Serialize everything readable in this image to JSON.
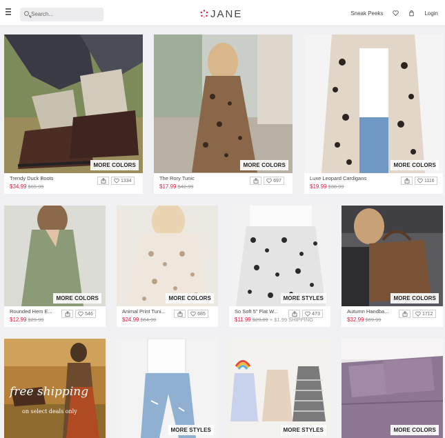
{
  "header": {
    "search_placeholder": "Search...",
    "logo": "JANE",
    "sneak_peeks": "Sneak Peeks",
    "login": "Login",
    "brand_color": "#e3173e"
  },
  "products": [
    {
      "name": "Trendy Duck Boots",
      "price": "$34.99",
      "was": "$69.99",
      "likes": "1334",
      "tag": "MORE COLORS"
    },
    {
      "name": "The Rory Tunic",
      "price": "$17.99",
      "was": "$42.99",
      "likes": "697",
      "tag": "MORE COLORS"
    },
    {
      "name": "Luxe Leopard Cardigans",
      "price": "$19.99",
      "was": "$38.99",
      "likes": "1116",
      "tag": "MORE COLORS"
    },
    {
      "name": "Rounded Hem E...",
      "price": "$12.99",
      "was": "$29.99",
      "likes": "546",
      "tag": "MORE COLORS"
    },
    {
      "name": "Animal Print Tuni...",
      "price": "$24.99",
      "was": "$64.99",
      "likes": "685",
      "tag": "MORE COLORS"
    },
    {
      "name": "So Soft 5\" Flat W...",
      "price": "$11.99",
      "was": "$29.99",
      "shipping": "+ $1.99 SHIPPING",
      "likes": "473",
      "tag": "MORE STYLES"
    },
    {
      "name": "Autumn Handba...",
      "price": "$32.99",
      "was": "$69.99",
      "likes": "1712",
      "tag": "MORE COLORS"
    },
    {
      "promo_line1": "free shipping",
      "promo_line2": "on select deals only"
    },
    {
      "tag": "MORE STYLES"
    },
    {
      "tag": "MORE STYLES"
    },
    {
      "tag": "MORE COLORS"
    }
  ]
}
